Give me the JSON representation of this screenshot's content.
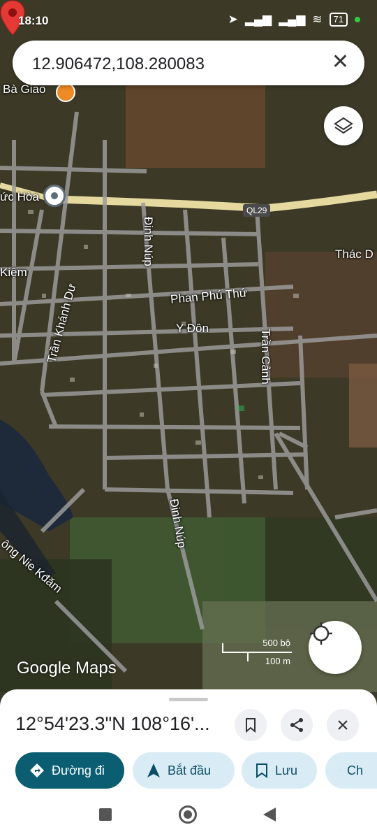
{
  "status_bar": {
    "time": "18:10",
    "battery": "71"
  },
  "search": {
    "query": "12.906472,108.280083"
  },
  "map_labels": {
    "poi_ba_giao": "Bà Giao",
    "place_duc_hoa": "ức Hòa",
    "place_kiem": "Kiệm",
    "place_thac": "Thác D",
    "road_ql29": "QL29",
    "road_dinh_nup_top": "Đinh Núp",
    "road_dinh_nup_bottom": "Đinh Núp",
    "road_phan_phu_thu": "Phan Phú Thứ",
    "road_y_don": "Y Đôn",
    "road_tran_khanh_du": "Trần Khánh Dư",
    "road_tran_canh": "Trần Cảnh",
    "river": "ông Nie Kđăm"
  },
  "scale": {
    "feet": "500 bộ",
    "meters": "100 m"
  },
  "logo": "Google Maps",
  "sheet": {
    "coordinates": "12°54'23.3\"N 108°16'...",
    "chips": {
      "directions": "Đường đi",
      "start": "Bắt đầu",
      "save": "Lưu",
      "share": "Ch"
    }
  },
  "colors": {
    "primary_chip": "#0b5e72",
    "secondary_chip": "#d9ecf5",
    "pin": "#e53935",
    "highway": "#e6d9a0"
  }
}
